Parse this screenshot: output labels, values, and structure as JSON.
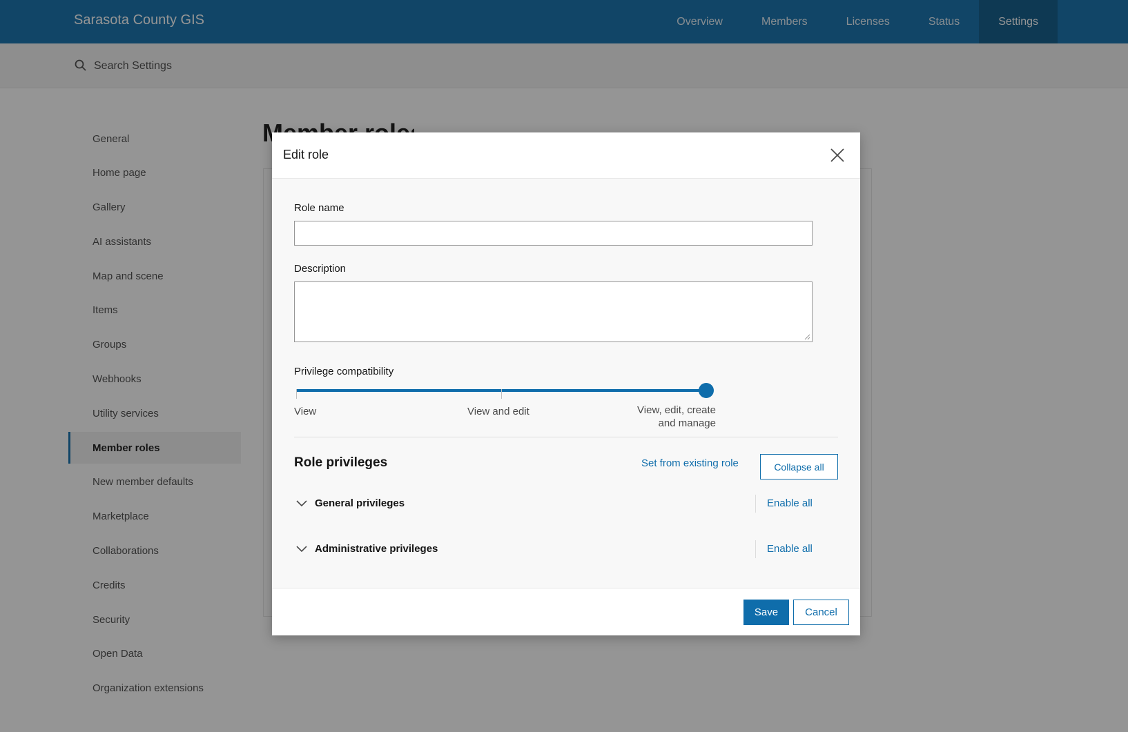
{
  "topnav": {
    "brand": "Sarasota County GIS",
    "tabs": [
      "Overview",
      "Members",
      "Licenses",
      "Status",
      "Settings"
    ],
    "active_tab": "Settings"
  },
  "search": {
    "placeholder": "Search Settings"
  },
  "sidebar": {
    "items": [
      {
        "label": "General"
      },
      {
        "label": "Home page"
      },
      {
        "label": "Gallery"
      },
      {
        "label": "AI assistants"
      },
      {
        "label": "Map and scene"
      },
      {
        "label": "Items"
      },
      {
        "label": "Groups"
      },
      {
        "label": "Webhooks"
      },
      {
        "label": "Utility services"
      },
      {
        "label": "Member roles"
      },
      {
        "label": "New member defaults"
      },
      {
        "label": "Marketplace"
      },
      {
        "label": "Collaborations"
      },
      {
        "label": "Credits"
      },
      {
        "label": "Security"
      },
      {
        "label": "Open Data"
      },
      {
        "label": "Organization extensions"
      }
    ],
    "active_item": "Member roles"
  },
  "page": {
    "title_partial": "Member roles"
  },
  "modal": {
    "title": "Edit role",
    "role_name": {
      "label": "Role name",
      "value": ""
    },
    "description": {
      "label": "Description",
      "value": ""
    },
    "privilege_compat": {
      "label": "Privilege compatibility",
      "options": [
        "View",
        "View and edit",
        "View, edit, create and manage"
      ],
      "option_lines": [
        "View, edit, create",
        "and manage"
      ],
      "selected": "View, edit, create and manage"
    },
    "role_privileges": {
      "heading": "Role privileges",
      "set_from_existing": "Set from existing role",
      "collapse_all": "Collapse all",
      "groups": [
        {
          "label": "General privileges",
          "action": "Enable all"
        },
        {
          "label": "Administrative privileges",
          "action": "Enable all"
        }
      ]
    },
    "footer": {
      "save": "Save",
      "cancel": "Cancel"
    }
  },
  "colors": {
    "brand_blue": "#0f6dab",
    "nav_active": "#0a5888",
    "overlay": "rgba(21,21,21,0.45)"
  }
}
